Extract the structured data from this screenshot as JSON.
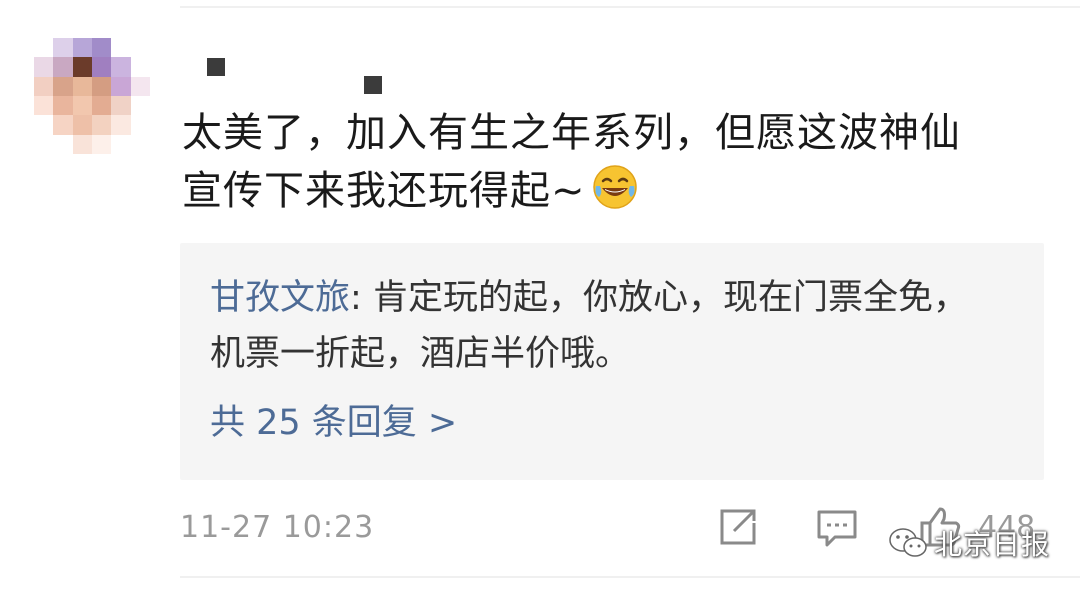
{
  "comment": {
    "text_line1": "太美了，加入有生之年系列，但愿这波神仙",
    "text_line2": "宣传下来我还玩得起~",
    "emoji": "laughing-with-tears-emoji"
  },
  "reply_preview": {
    "author": "甘孜文旅",
    "separator": ": ",
    "text": "肯定玩的起，你放心，现在门票全免，机票一折起，酒店半价哦。",
    "more_replies_label": "共 25 条回复 >"
  },
  "footer": {
    "timestamp": "11-27 10:23",
    "like_count": "448",
    "icons": [
      "share-icon",
      "comment-icon",
      "like-icon"
    ]
  },
  "watermark": {
    "text": "北京日报",
    "icon": "wechat-icon"
  },
  "colors": {
    "link_blue": "#4d6b96",
    "body_text": "#1a1a1a",
    "meta_gray": "#9a9a9a",
    "reply_bg": "#f5f5f5"
  }
}
